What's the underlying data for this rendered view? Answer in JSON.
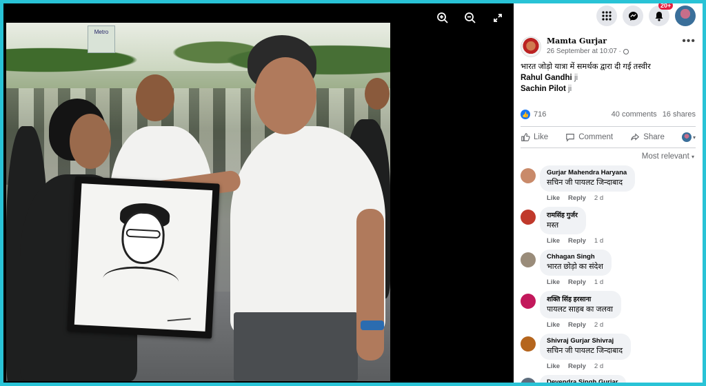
{
  "viewer": {
    "tools": [
      "zoom-in-icon",
      "zoom-out-icon",
      "fullscreen-icon"
    ],
    "photo_sign_text": "Metro"
  },
  "topbar": {
    "notifications_badge": "20+"
  },
  "post": {
    "author": "Mamta Gurjar",
    "timestamp": "26 September at 10:07 ·",
    "text": "भारत जोड़ो यात्रा में समर्थक द्वारा दी गई तस्वीर",
    "tags": [
      {
        "name": "Rahul Gandhi",
        "suffix": "ji"
      },
      {
        "name": "Sachin Pilot",
        "suffix": "ji"
      }
    ],
    "reactions": "716",
    "comments_count": "40 comments",
    "shares_count": "16 shares",
    "actions": {
      "like": "Like",
      "comment": "Comment",
      "share": "Share"
    },
    "sort_label": "Most relevant"
  },
  "comments": [
    {
      "name": "Gurjar Mahendra Haryana",
      "text": "सचिन जी पायलट जिन्दाबाद",
      "like": "Like",
      "reply": "Reply",
      "age": "2 d",
      "avatar_color": "#c98a6a"
    },
    {
      "name": "रामसिंह गुर्जर",
      "text": "मस्त",
      "like": "Like",
      "reply": "Reply",
      "age": "1 d",
      "avatar_color": "#c0392b"
    },
    {
      "name": "Chhagan Singh",
      "text": "भारत छोड़ो का संदेश",
      "like": "Like",
      "reply": "Reply",
      "age": "1 d",
      "avatar_color": "#9a8c7a"
    },
    {
      "name": "शक्ति सिंह हरसाना",
      "text": "पायलट साहब का जलवा",
      "like": "Like",
      "reply": "Reply",
      "age": "2 d",
      "avatar_color": "#c2185b"
    },
    {
      "name": "Shivraj Gurjar Shivraj",
      "text": "सचिन जी पायलट जिन्दाबाद",
      "like": "Like",
      "reply": "Reply",
      "age": "2 d",
      "avatar_color": "#b5651d"
    },
    {
      "name": "Devendra Singh Gurjar",
      "text": "",
      "like": "",
      "reply": "",
      "age": "",
      "avatar_color": "#5d6d7e"
    }
  ],
  "colors": {
    "accent": "#1877f2",
    "frame": "#29c3d6",
    "badge": "#e41e3f"
  }
}
